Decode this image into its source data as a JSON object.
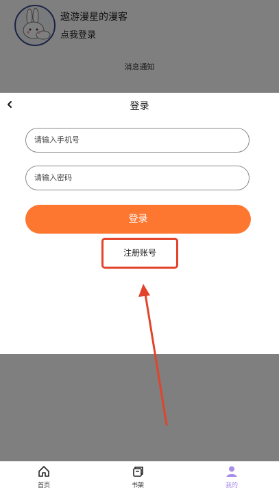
{
  "profile": {
    "name": "遨游漫星的漫客",
    "login_prompt": "点我登录",
    "notice_row": "消息通知"
  },
  "modal": {
    "title": "登录",
    "phone_placeholder": "请输入手机号",
    "password_placeholder": "请输入密码",
    "login_button": "登录",
    "register_link": "注册账号"
  },
  "tabbar": {
    "items": [
      {
        "label": "首页",
        "icon": "home-icon",
        "active": false
      },
      {
        "label": "书架",
        "icon": "bookshelf-icon",
        "active": false
      },
      {
        "label": "我的",
        "icon": "user-icon",
        "active": true
      }
    ]
  },
  "colors": {
    "accent": "#fd7731",
    "annotation": "#e2432a",
    "active_tab": "#a98ee8"
  }
}
